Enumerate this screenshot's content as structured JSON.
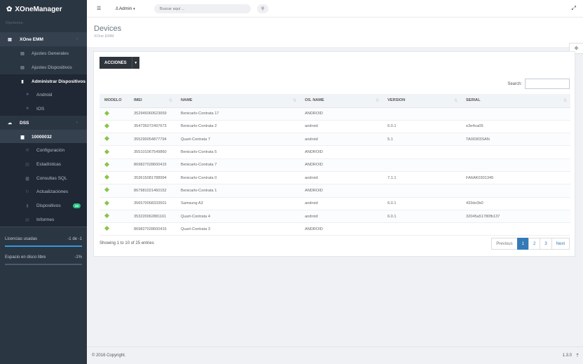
{
  "app": {
    "title": "XOneManager"
  },
  "sidebar": {
    "heading": "Opciones",
    "items": [
      {
        "label": "XOne EMM",
        "icon": "server-icon"
      },
      {
        "label": "Ajustes Generales",
        "icon": "list-icon"
      },
      {
        "label": "Ajustes Dispositivos",
        "icon": "list-icon"
      },
      {
        "label": "Administrar Dispositivos",
        "icon": "mobile-icon"
      },
      {
        "label": "Android",
        "icon": "android-icon"
      },
      {
        "label": "IOS",
        "icon": "apple-icon"
      },
      {
        "label": "DSS",
        "icon": "cloud-icon"
      },
      {
        "label": "10000032",
        "icon": "database-icon"
      },
      {
        "label": "Configuración",
        "icon": "wrench-icon"
      },
      {
        "label": "Estadísticas",
        "icon": "chart-icon"
      },
      {
        "label": "Consultas SQL",
        "icon": "database-icon"
      },
      {
        "label": "Actualizaciones",
        "icon": "refresh-icon"
      },
      {
        "label": "Dispositivos",
        "icon": "tablet-icon",
        "badge": "24"
      },
      {
        "label": "Informes",
        "icon": "document-icon"
      }
    ],
    "stats": [
      {
        "label": "Licencias usadas",
        "value": "-1 de -1",
        "fill": 1.0
      },
      {
        "label": "Espacio en disco libre",
        "value": "-1%",
        "fill": 0
      }
    ]
  },
  "header": {
    "user": "Admin",
    "search_placeholder": "Buscar aquí ..."
  },
  "page": {
    "title": "Devices",
    "subtitle": "XOne EMM"
  },
  "toolbar": {
    "actions_label": "ACCIONES",
    "search_label": "Search:"
  },
  "table": {
    "columns": [
      "MODELO",
      "IMEI",
      "NAME",
      "OS. NAME",
      "VERSION",
      "SERIAL"
    ],
    "rows": [
      [
        "",
        "352945060623659",
        "Benicarlo-Contrata 17",
        "ANDROID",
        "",
        ""
      ],
      [
        "",
        "354735072497673",
        "Benicarlo-Contrata 2",
        "android",
        "6.0.1",
        "e3e4ca05"
      ],
      [
        "",
        "355290054877794",
        "Quart-Contrata 7",
        "android",
        "5.1",
        "TA00303SAN"
      ],
      [
        "",
        "355101067549860",
        "Benicarlo-Contrata 5",
        "ANDROID",
        "",
        ""
      ],
      [
        "",
        "869827028600415",
        "Benicarlo-Contrata 7",
        "ANDROID",
        "",
        ""
      ],
      [
        "",
        "353615081788994",
        "Benicarlo-Contrata 0",
        "android",
        "7.1.1",
        "FA6AK0301345"
      ],
      [
        "",
        "867981021460152",
        "Benicarlo-Contrata 1",
        "ANDROID",
        "",
        ""
      ],
      [
        "",
        "356570068333501",
        "Samsung A3",
        "android",
        "6.0.1",
        "433dc0b0"
      ],
      [
        "",
        "353220062881161",
        "Quart-Contrata 4",
        "android",
        "6.0.1",
        "32045a51780fb137"
      ],
      [
        "",
        "869827028600415",
        "Quart-Contrata 3",
        "ANDROID",
        "",
        ""
      ]
    ],
    "info": "Showing 1 to 10 of 25 entries"
  },
  "pagination": {
    "prev": "Previous",
    "pages": [
      "1",
      "2",
      "3"
    ],
    "next": "Next",
    "current": "1"
  },
  "footer": {
    "copyright": "© 2016 Copyright.",
    "version": "1.3.0"
  },
  "colors": {
    "sidebar_bg": "#2b3643",
    "accent": "#337ab7",
    "status_green": "#8bc34a"
  }
}
